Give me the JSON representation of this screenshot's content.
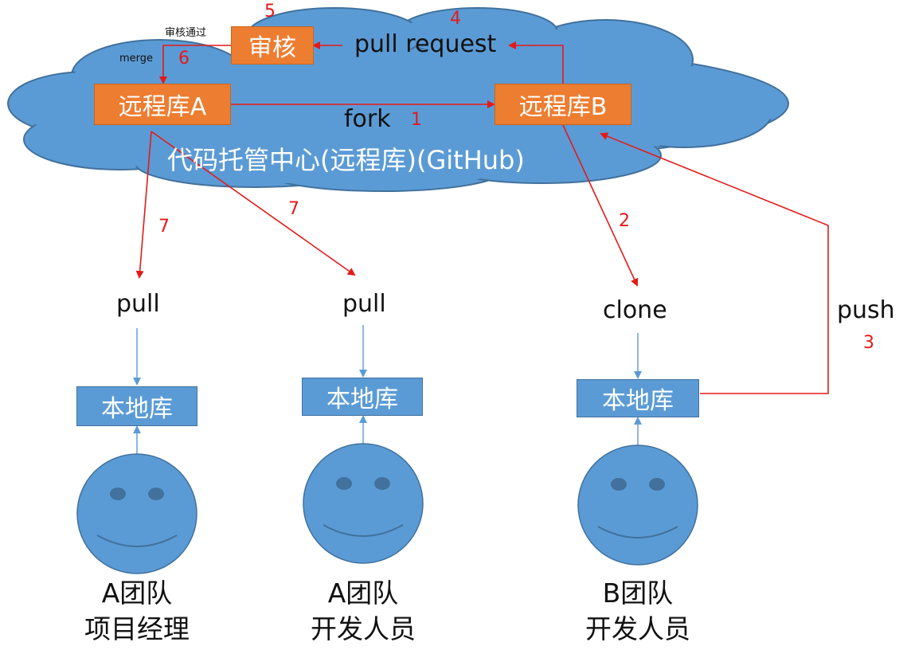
{
  "cloud": {
    "label": "代码托管中心(远程库)(GitHub)",
    "fill": "#5b9bd5"
  },
  "remote_a": {
    "label": "远程库A"
  },
  "remote_b": {
    "label": "远程库B"
  },
  "review": {
    "label": "审核"
  },
  "edges": {
    "fork": "fork",
    "pull_request": "pull request",
    "review_pass": "审核通过",
    "merge": "merge",
    "clone": "clone",
    "push": "push",
    "pull_left": "pull",
    "pull_middle": "pull"
  },
  "steps": {
    "s1": "1",
    "s2": "2",
    "s3": "3",
    "s4": "4",
    "s5": "5",
    "s6": "6",
    "s7a": "7",
    "s7b": "7"
  },
  "local_repos": {
    "left": "本地库",
    "middle": "本地库",
    "right": "本地库"
  },
  "people": [
    {
      "team": "A团队",
      "role": "项目经理"
    },
    {
      "team": "A团队",
      "role": "开发人员"
    },
    {
      "team": "B团队",
      "role": "开发人员"
    }
  ],
  "colors": {
    "orange": "#ed7d31",
    "blue": "#5b9bd5",
    "red_arrow": "#e41a1a",
    "blue_arrow": "#5b9bd5"
  }
}
